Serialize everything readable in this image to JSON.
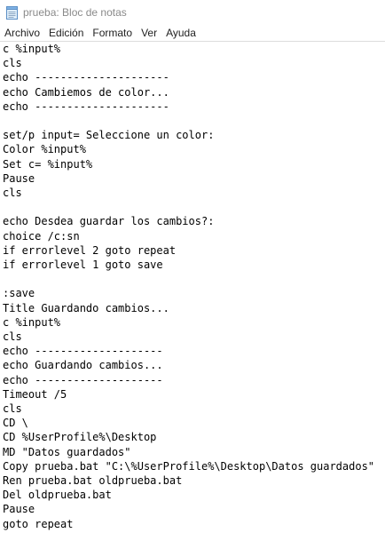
{
  "window": {
    "title": "prueba: Bloc de notas",
    "icon": "notepad-icon"
  },
  "menu": [
    {
      "label": "Archivo"
    },
    {
      "label": "Edición"
    },
    {
      "label": "Formato"
    },
    {
      "label": "Ver"
    },
    {
      "label": "Ayuda"
    }
  ],
  "editor": {
    "lines": [
      "c %input%",
      "cls",
      "echo ---------------------",
      "echo Cambiemos de color...",
      "echo ---------------------",
      "",
      "set/p input= Seleccione un color:",
      "Color %input%",
      "Set c= %input%",
      "Pause",
      "cls",
      "",
      "echo Desdea guardar los cambios?:",
      "choice /c:sn",
      "if errorlevel 2 goto repeat",
      "if errorlevel 1 goto save",
      "",
      ":save",
      "Title Guardando cambios...",
      "c %input%",
      "cls",
      "echo --------------------",
      "echo Guardando cambios...",
      "echo --------------------",
      "Timeout /5",
      "cls",
      "CD \\",
      "CD %UserProfile%\\Desktop",
      "MD \"Datos guardados\"",
      "Copy prueba.bat \"C:\\%UserProfile%\\Desktop\\Datos guardados\"",
      "Ren prueba.bat oldprueba.bat",
      "Del oldprueba.bat",
      "Pause",
      "goto repeat"
    ]
  }
}
